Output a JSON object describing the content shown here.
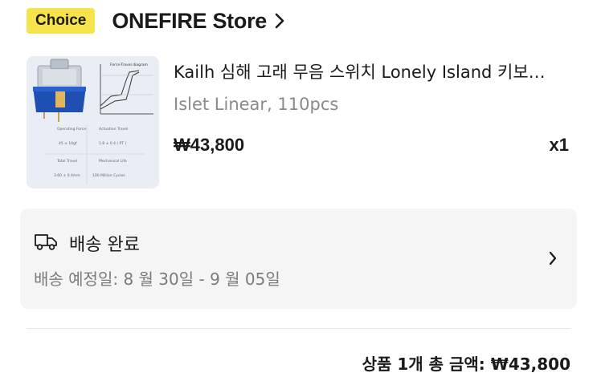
{
  "store": {
    "badge": "Choice",
    "name": "ONEFIRE Store"
  },
  "product": {
    "title": "Kailh 심해 고래 무음 스위치 Lonely Island 키보…",
    "variant": "Islet Linear, 110pcs",
    "price": "₩43,800",
    "quantity": "x1",
    "thumbnail": {
      "chart_title": "Force-Travel diagram",
      "operating_force_label": "Operating Force",
      "operating_force_value": "45 ± 10gf",
      "actuation_travel_label": "Actuation Travel",
      "actuation_travel_value": "1.8 ± 0.4 ( PT )",
      "total_travel_label": "Total Travel",
      "total_travel_value": "3.60 ± 0.4mm",
      "mechanical_life_label": "Mechanical Life",
      "mechanical_life_value": "100 Million Cycles"
    }
  },
  "delivery": {
    "status": "배송 완료",
    "estimate": "배송 예정일: 8 월 30일 - 9 월 05일"
  },
  "summary": {
    "total": "상품 1개 총 금액: ₩43,800"
  },
  "colors": {
    "choice_badge": "#f7e34b",
    "card_background": "#f5f5f5",
    "muted_text": "#8a8a8a",
    "switch_blue": "#1f4fb3"
  }
}
